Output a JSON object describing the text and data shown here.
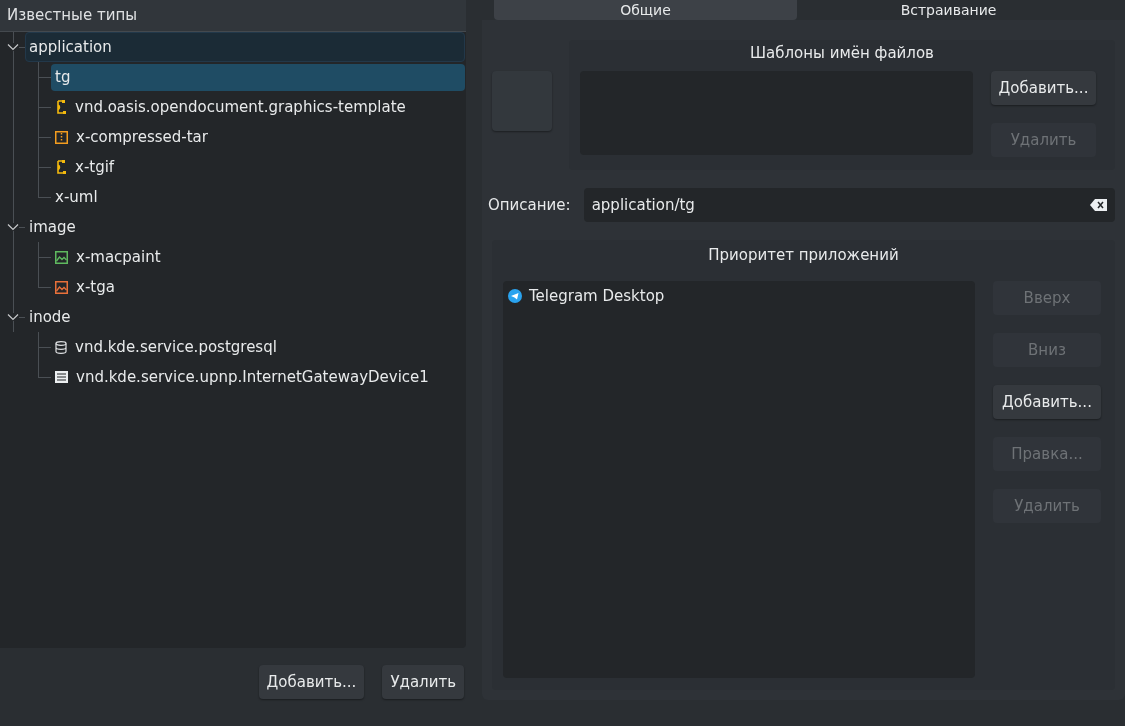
{
  "tree": {
    "header": "Известные типы",
    "groups": [
      {
        "label": "application",
        "expanded": true,
        "hovered": true,
        "children": [
          {
            "label": "tg",
            "selected": true
          },
          {
            "label": "vnd.oasis.opendocument.graphics-template",
            "selected": false,
            "kind": "vector"
          },
          {
            "label": "x-compressed-tar",
            "selected": false,
            "kind": "archive"
          },
          {
            "label": "x-tgif",
            "selected": false,
            "kind": "vector"
          },
          {
            "label": "x-uml",
            "selected": false
          }
        ]
      },
      {
        "label": "image",
        "expanded": true,
        "hovered": false,
        "children": [
          {
            "label": "x-macpaint",
            "selected": false,
            "kind": "image",
            "color": "#5fb95f"
          },
          {
            "label": "x-tga",
            "selected": false,
            "kind": "image",
            "color": "#e8703a"
          }
        ]
      },
      {
        "label": "inode",
        "expanded": true,
        "hovered": false,
        "children": [
          {
            "label": "vnd.kde.service.postgresql",
            "selected": false,
            "kind": "database"
          },
          {
            "label": "vnd.kde.service.upnp.InternetGatewayDevice1",
            "selected": false,
            "kind": "document"
          }
        ]
      }
    ]
  },
  "tree_buttons": [
    {
      "label": "Добавить...",
      "disabled": false
    },
    {
      "label": "Удалить",
      "disabled": false
    }
  ],
  "tabs": [
    {
      "label": "Общие",
      "selected": true
    },
    {
      "label": "Встраивание",
      "selected": false
    }
  ],
  "patterns": {
    "title": "Шаблоны имён файлов",
    "buttons": [
      {
        "label": "Добавить...",
        "disabled": false
      },
      {
        "label": "Удалить",
        "disabled": true
      }
    ]
  },
  "description": {
    "label": "Описание:",
    "value": "application/tg"
  },
  "priority": {
    "title": "Приоритет приложений",
    "apps": [
      {
        "label": "Telegram Desktop"
      }
    ],
    "buttons": [
      {
        "label": "Вверх",
        "disabled": true
      },
      {
        "label": "Вниз",
        "disabled": true
      },
      {
        "label": "Добавить...",
        "disabled": false
      },
      {
        "label": "Правка...",
        "disabled": true
      },
      {
        "label": "Удалить",
        "disabled": true
      }
    ]
  }
}
